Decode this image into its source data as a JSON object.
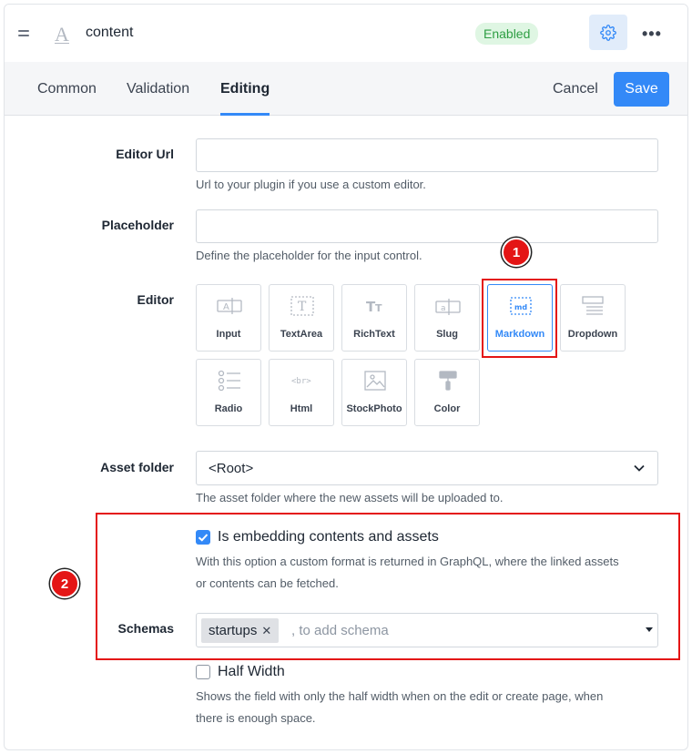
{
  "header": {
    "field_name": "content",
    "status_badge": "Enabled"
  },
  "tabs": [
    {
      "label": "Common",
      "active": false
    },
    {
      "label": "Validation",
      "active": false
    },
    {
      "label": "Editing",
      "active": true
    }
  ],
  "actions": {
    "cancel": "Cancel",
    "save": "Save"
  },
  "form": {
    "editor_url": {
      "label": "Editor Url",
      "value": "",
      "hint": "Url to your plugin if you use a custom editor."
    },
    "placeholder": {
      "label": "Placeholder",
      "value": "",
      "hint": "Define the placeholder for the input control."
    },
    "editor": {
      "label": "Editor",
      "selected": "Markdown",
      "options": [
        {
          "label": "Input",
          "icon": "input-icon"
        },
        {
          "label": "TextArea",
          "icon": "textarea-icon"
        },
        {
          "label": "RichText",
          "icon": "richtext-icon"
        },
        {
          "label": "Slug",
          "icon": "slug-icon"
        },
        {
          "label": "Markdown",
          "icon": "markdown-icon"
        },
        {
          "label": "Dropdown",
          "icon": "dropdown-icon"
        },
        {
          "label": "Radio",
          "icon": "radio-icon"
        },
        {
          "label": "Html",
          "icon": "html-icon"
        },
        {
          "label": "StockPhoto",
          "icon": "stockphoto-icon"
        },
        {
          "label": "Color",
          "icon": "color-icon"
        }
      ]
    },
    "asset_folder": {
      "label": "Asset folder",
      "value": "<Root>",
      "hint": "The asset folder where the new assets will be uploaded to."
    },
    "embedding": {
      "label": "Is embedding contents and assets",
      "checked": true,
      "hint_line1": "With this option a custom format is returned in GraphQL, where the linked assets",
      "hint_line2": "or contents can be fetched."
    },
    "schemas": {
      "label": "Schemas",
      "tags": [
        "startups"
      ],
      "placeholder": ", to add schema"
    },
    "half_width": {
      "label": "Half Width",
      "checked": false,
      "hint_line1": "Shows the field with only the half width when on the edit or create page, when",
      "hint_line2": "there is enough space."
    }
  },
  "annotations": {
    "callout_1": "1",
    "callout_2": "2"
  },
  "colors": {
    "accent": "#3389f7",
    "annotation_red": "#e41515",
    "badge_green": "#2e9e43"
  }
}
